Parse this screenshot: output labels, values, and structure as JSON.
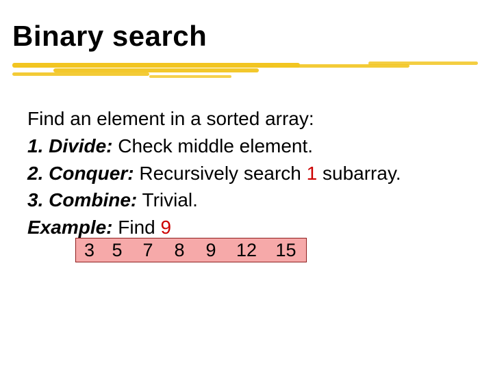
{
  "title": "Binary search",
  "body": {
    "intro": "Find an element in a sorted array:",
    "step1_label": "1. Divide:",
    "step1_text": " Check middle element.",
    "step2_label": "2. Conquer:",
    "step2_text_a": " Recursively search ",
    "step2_red": "1",
    "step2_text_b": " subarray.",
    "step3_label": "3. Combine:",
    "step3_text": " Trivial.",
    "example_label": "Example:",
    "example_text": " Find ",
    "example_target": "9"
  },
  "array": [
    "3",
    "5",
    "7",
    "8",
    "9",
    "12",
    "15"
  ],
  "colors": {
    "accent_underline": "#f2c521",
    "array_fill": "#f6a9a9",
    "array_border": "#8e1d1d",
    "red_text": "#cc0000"
  }
}
